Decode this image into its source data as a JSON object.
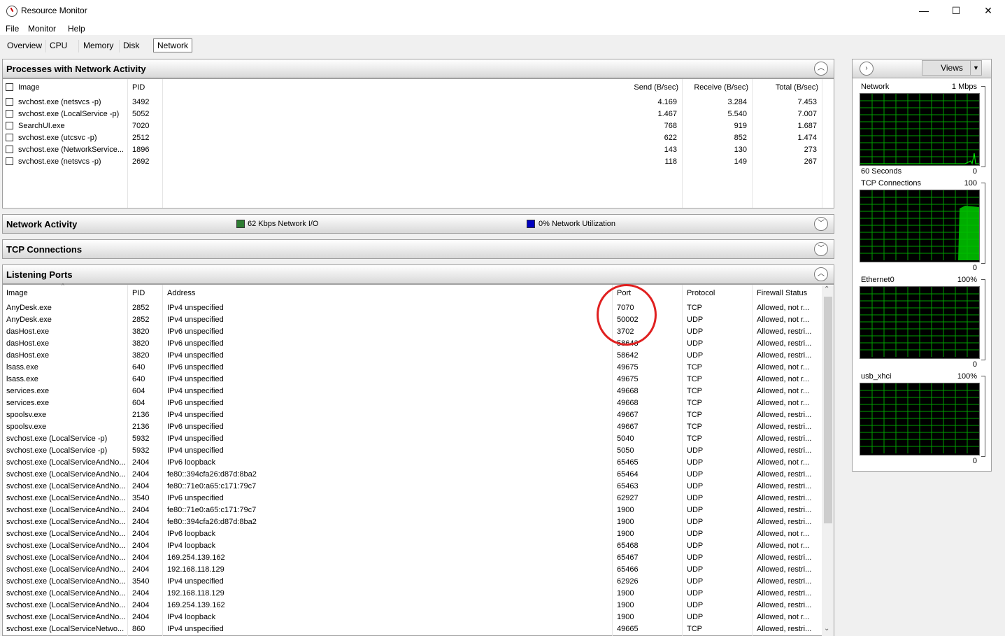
{
  "window": {
    "title": "Resource Monitor",
    "minimize": "—",
    "maximize": "☐",
    "close": "✕"
  },
  "menu": [
    "File",
    "Monitor",
    "Help"
  ],
  "tabs": [
    "Overview",
    "CPU",
    "Memory",
    "Disk",
    "Network"
  ],
  "active_tab": "Network",
  "processes": {
    "title": "Processes with Network Activity",
    "columns": [
      "Image",
      "PID",
      "Send (B/sec)",
      "Receive (B/sec)",
      "Total (B/sec)"
    ],
    "rows": [
      [
        "svchost.exe (netsvcs -p)",
        "3492",
        "4.169",
        "3.284",
        "7.453"
      ],
      [
        "svchost.exe (LocalService -p)",
        "5052",
        "1.467",
        "5.540",
        "7.007"
      ],
      [
        "SearchUI.exe",
        "7020",
        "768",
        "919",
        "1.687"
      ],
      [
        "svchost.exe (utcsvc -p)",
        "2512",
        "622",
        "852",
        "1.474"
      ],
      [
        "svchost.exe (NetworkService...",
        "1896",
        "143",
        "130",
        "273"
      ],
      [
        "svchost.exe (netsvcs -p)",
        "2692",
        "118",
        "149",
        "267"
      ]
    ]
  },
  "network_activity": {
    "title": "Network Activity",
    "io": "62 Kbps Network I/O",
    "utilization": "0% Network Utilization",
    "io_color": "#2e7d32",
    "util_color": "#0000c0"
  },
  "tcp": {
    "title": "TCP Connections"
  },
  "listening": {
    "title": "Listening Ports",
    "columns": [
      "Image",
      "PID",
      "Address",
      "Port",
      "Protocol",
      "Firewall Status"
    ],
    "rows": [
      [
        "AnyDesk.exe",
        "2852",
        "IPv4 unspecified",
        "7070",
        "TCP",
        "Allowed, not r..."
      ],
      [
        "AnyDesk.exe",
        "2852",
        "IPv4 unspecified",
        "50002",
        "UDP",
        "Allowed, not r..."
      ],
      [
        "dasHost.exe",
        "3820",
        "IPv6 unspecified",
        "3702",
        "UDP",
        "Allowed, restri..."
      ],
      [
        "dasHost.exe",
        "3820",
        "IPv6 unspecified",
        "58643",
        "UDP",
        "Allowed, restri..."
      ],
      [
        "dasHost.exe",
        "3820",
        "IPv4 unspecified",
        "58642",
        "UDP",
        "Allowed, restri..."
      ],
      [
        "lsass.exe",
        "640",
        "IPv6 unspecified",
        "49675",
        "TCP",
        "Allowed, not r..."
      ],
      [
        "lsass.exe",
        "640",
        "IPv4 unspecified",
        "49675",
        "TCP",
        "Allowed, not r..."
      ],
      [
        "services.exe",
        "604",
        "IPv4 unspecified",
        "49668",
        "TCP",
        "Allowed, not r..."
      ],
      [
        "services.exe",
        "604",
        "IPv6 unspecified",
        "49668",
        "TCP",
        "Allowed, not r..."
      ],
      [
        "spoolsv.exe",
        "2136",
        "IPv4 unspecified",
        "49667",
        "TCP",
        "Allowed, restri..."
      ],
      [
        "spoolsv.exe",
        "2136",
        "IPv6 unspecified",
        "49667",
        "TCP",
        "Allowed, restri..."
      ],
      [
        "svchost.exe (LocalService -p)",
        "5932",
        "IPv4 unspecified",
        "5040",
        "TCP",
        "Allowed, restri..."
      ],
      [
        "svchost.exe (LocalService -p)",
        "5932",
        "IPv4 unspecified",
        "5050",
        "UDP",
        "Allowed, restri..."
      ],
      [
        "svchost.exe (LocalServiceAndNo...",
        "2404",
        "IPv6 loopback",
        "65465",
        "UDP",
        "Allowed, not r..."
      ],
      [
        "svchost.exe (LocalServiceAndNo...",
        "2404",
        "fe80::394cfa26:d87d:8ba2",
        "65464",
        "UDP",
        "Allowed, restri..."
      ],
      [
        "svchost.exe (LocalServiceAndNo...",
        "2404",
        "fe80::71e0:a65:c171:79c7",
        "65463",
        "UDP",
        "Allowed, restri..."
      ],
      [
        "svchost.exe (LocalServiceAndNo...",
        "3540",
        "IPv6 unspecified",
        "62927",
        "UDP",
        "Allowed, restri..."
      ],
      [
        "svchost.exe (LocalServiceAndNo...",
        "2404",
        "fe80::71e0:a65:c171:79c7",
        "1900",
        "UDP",
        "Allowed, restri..."
      ],
      [
        "svchost.exe (LocalServiceAndNo...",
        "2404",
        "fe80::394cfa26:d87d:8ba2",
        "1900",
        "UDP",
        "Allowed, restri..."
      ],
      [
        "svchost.exe (LocalServiceAndNo...",
        "2404",
        "IPv6 loopback",
        "1900",
        "UDP",
        "Allowed, not r..."
      ],
      [
        "svchost.exe (LocalServiceAndNo...",
        "2404",
        "IPv4 loopback",
        "65468",
        "UDP",
        "Allowed, not r..."
      ],
      [
        "svchost.exe (LocalServiceAndNo...",
        "2404",
        "169.254.139.162",
        "65467",
        "UDP",
        "Allowed, restri..."
      ],
      [
        "svchost.exe (LocalServiceAndNo...",
        "2404",
        "192.168.118.129",
        "65466",
        "UDP",
        "Allowed, restri..."
      ],
      [
        "svchost.exe (LocalServiceAndNo...",
        "3540",
        "IPv4 unspecified",
        "62926",
        "UDP",
        "Allowed, restri..."
      ],
      [
        "svchost.exe (LocalServiceAndNo...",
        "2404",
        "192.168.118.129",
        "1900",
        "UDP",
        "Allowed, restri..."
      ],
      [
        "svchost.exe (LocalServiceAndNo...",
        "2404",
        "169.254.139.162",
        "1900",
        "UDP",
        "Allowed, restri..."
      ],
      [
        "svchost.exe (LocalServiceAndNo...",
        "2404",
        "IPv4 loopback",
        "1900",
        "UDP",
        "Allowed, not r..."
      ],
      [
        "svchost.exe (LocalServiceNetwo...",
        "860",
        "IPv4 unspecified",
        "49665",
        "TCP",
        "Allowed, restri..."
      ]
    ]
  },
  "right_pane": {
    "views_label": "Views",
    "graphs": [
      {
        "title": "Network",
        "max": "1 Mbps",
        "footer_left": "60 Seconds",
        "footer_right": "0"
      },
      {
        "title": "TCP Connections",
        "max": "100",
        "footer_left": "",
        "footer_right": "0"
      },
      {
        "title": "Ethernet0",
        "max": "100%",
        "footer_left": "",
        "footer_right": "0"
      },
      {
        "title": "usb_xhci",
        "max": "100%",
        "footer_left": "",
        "footer_right": "0"
      }
    ]
  },
  "colors": {
    "graph_grid": "#00a000",
    "graph_line": "#00ff00",
    "annotation": "#e02020"
  }
}
